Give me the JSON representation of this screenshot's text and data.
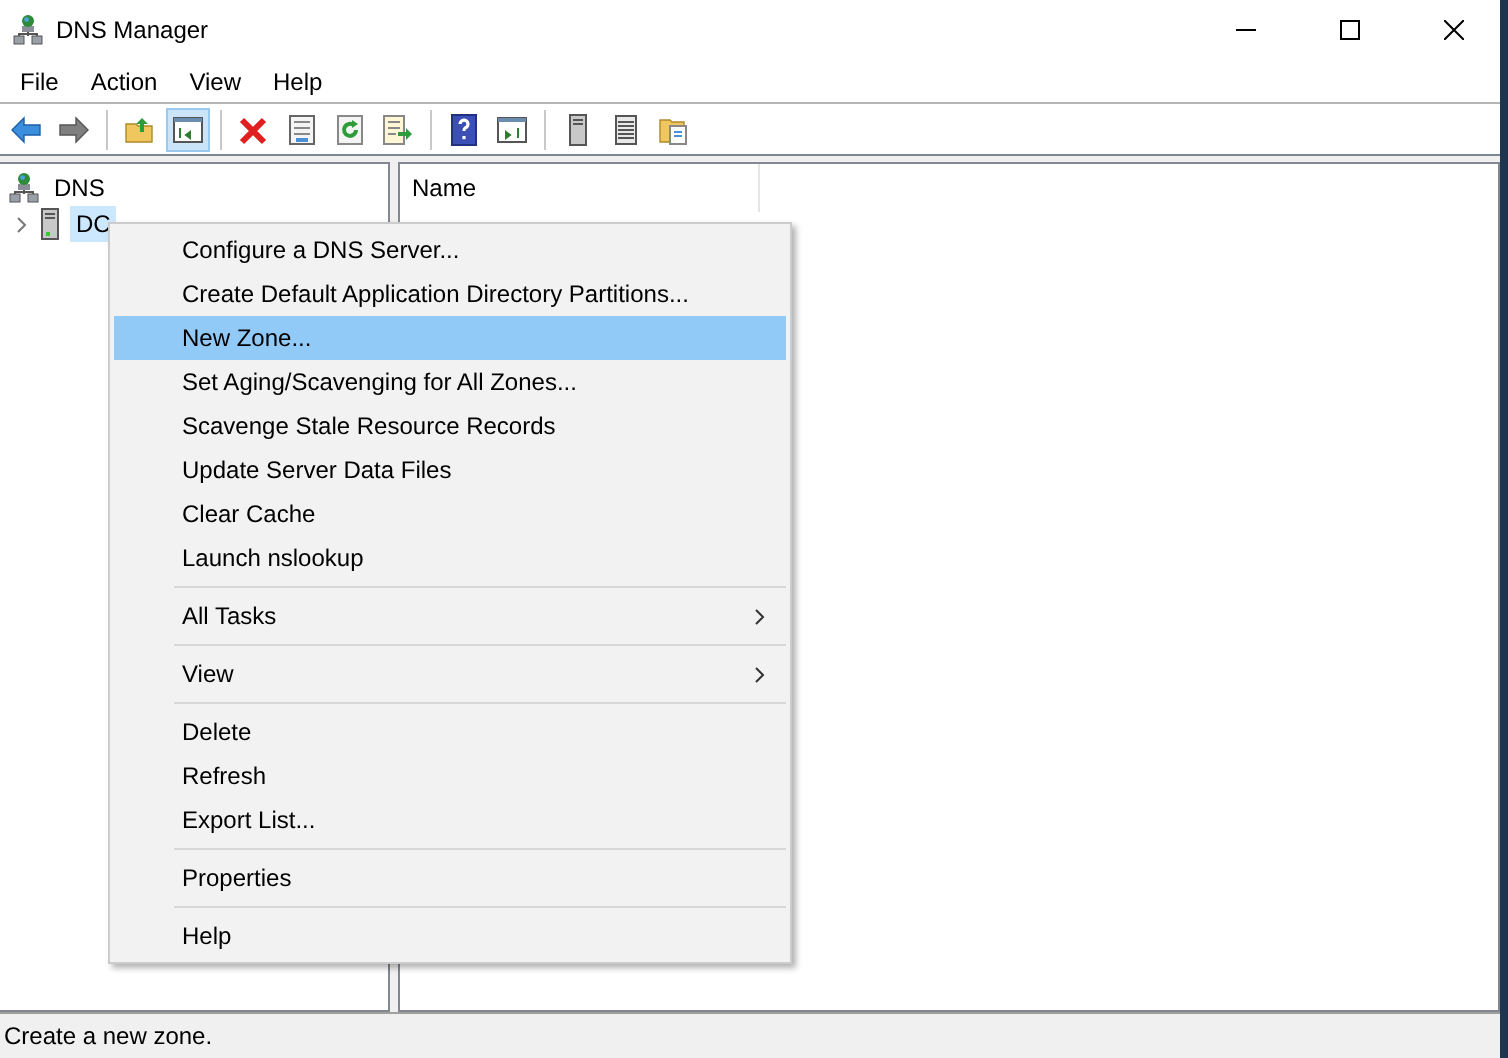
{
  "window": {
    "title": "DNS Manager"
  },
  "menu_bar": [
    "File",
    "Action",
    "View",
    "Help"
  ],
  "toolbar": [
    {
      "kind": "back",
      "pressed": false
    },
    {
      "kind": "forward",
      "pressed": false
    },
    {
      "kind": "sep"
    },
    {
      "kind": "up",
      "pressed": false
    },
    {
      "kind": "tree",
      "pressed": true
    },
    {
      "kind": "sep"
    },
    {
      "kind": "delete",
      "pressed": false
    },
    {
      "kind": "properties",
      "pressed": false
    },
    {
      "kind": "refresh",
      "pressed": false
    },
    {
      "kind": "export",
      "pressed": false
    },
    {
      "kind": "sep"
    },
    {
      "kind": "help",
      "pressed": false
    },
    {
      "kind": "pane",
      "pressed": false
    },
    {
      "kind": "sep"
    },
    {
      "kind": "server",
      "pressed": false
    },
    {
      "kind": "list",
      "pressed": false
    },
    {
      "kind": "folders",
      "pressed": false
    }
  ],
  "tree": [
    {
      "label": "DNS",
      "kind": "root",
      "selected": false,
      "children": [
        {
          "label": "DC",
          "kind": "server",
          "selected": true,
          "expanded": false
        }
      ]
    }
  ],
  "list_columns": [
    "Name"
  ],
  "context_menu": [
    {
      "kind": "item",
      "label": "Configure a DNS Server...",
      "selected": false
    },
    {
      "kind": "item",
      "label": "Create Default Application Directory Partitions...",
      "selected": false
    },
    {
      "kind": "item",
      "label": "New Zone...",
      "selected": true
    },
    {
      "kind": "item",
      "label": "Set Aging/Scavenging for All Zones...",
      "selected": false
    },
    {
      "kind": "item",
      "label": "Scavenge Stale Resource Records",
      "selected": false
    },
    {
      "kind": "item",
      "label": "Update Server Data Files",
      "selected": false
    },
    {
      "kind": "item",
      "label": "Clear Cache",
      "selected": false
    },
    {
      "kind": "item",
      "label": "Launch nslookup",
      "selected": false
    },
    {
      "kind": "separator"
    },
    {
      "kind": "submenu",
      "label": "All Tasks",
      "selected": false
    },
    {
      "kind": "separator"
    },
    {
      "kind": "submenu",
      "label": "View",
      "selected": false
    },
    {
      "kind": "separator"
    },
    {
      "kind": "item",
      "label": "Delete",
      "selected": false
    },
    {
      "kind": "item",
      "label": "Refresh",
      "selected": false
    },
    {
      "kind": "item",
      "label": "Export List...",
      "selected": false
    },
    {
      "kind": "separator"
    },
    {
      "kind": "item",
      "label": "Properties",
      "selected": false
    },
    {
      "kind": "separator"
    },
    {
      "kind": "item",
      "label": "Help",
      "selected": false
    }
  ],
  "status_bar": "Create a new zone."
}
